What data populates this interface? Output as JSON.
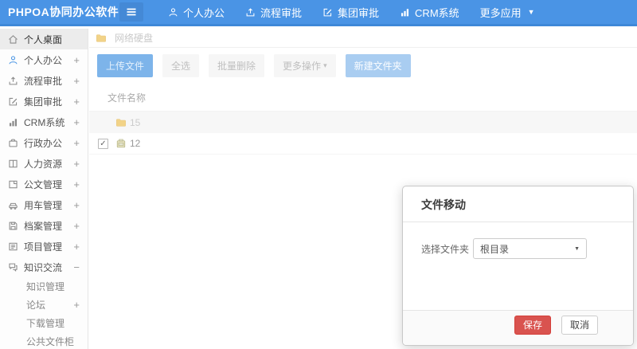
{
  "header": {
    "logo": "PHPOA协同办公软件",
    "nav": [
      {
        "name": "nav-item-personal-office",
        "label": "个人办公",
        "icon": "person-icon"
      },
      {
        "name": "nav-item-workflow-approval",
        "label": "流程审批",
        "icon": "approve-icon"
      },
      {
        "name": "nav-item-group-approval",
        "label": "集团审批",
        "icon": "edit-icon"
      },
      {
        "name": "nav-item-crm-system",
        "label": "CRM系统",
        "icon": "chart-icon"
      },
      {
        "name": "nav-item-more-apps",
        "label": "更多应用",
        "icon": "",
        "caret": "▼"
      }
    ]
  },
  "sidebar": {
    "items": [
      {
        "name": "sidebar-item-personal-desktop",
        "label": "个人桌面",
        "icon": "home-icon",
        "active": true
      },
      {
        "name": "sidebar-item-personal-office",
        "label": "个人办公",
        "icon": "person-icon",
        "icon_color": "#4a95e4",
        "expand": "+"
      },
      {
        "name": "sidebar-item-workflow-approval",
        "label": "流程审批",
        "icon": "approve-icon",
        "expand": "+"
      },
      {
        "name": "sidebar-item-group-approval",
        "label": "集团审批",
        "icon": "edit-icon",
        "expand": "+"
      },
      {
        "name": "sidebar-item-crm-system",
        "label": "CRM系统",
        "icon": "chart-icon",
        "expand": "+"
      },
      {
        "name": "sidebar-item-admin-office",
        "label": "行政办公",
        "icon": "briefcase-icon",
        "expand": "+"
      },
      {
        "name": "sidebar-item-human-resources",
        "label": "人力资源",
        "icon": "book-icon",
        "expand": "+"
      },
      {
        "name": "sidebar-item-document-mgmt",
        "label": "公文管理",
        "icon": "doc-icon",
        "expand": "+"
      },
      {
        "name": "sidebar-item-vehicle-mgmt",
        "label": "用车管理",
        "icon": "car-icon",
        "expand": "+"
      },
      {
        "name": "sidebar-item-archive-mgmt",
        "label": "档案管理",
        "icon": "disk-icon",
        "expand": "+"
      },
      {
        "name": "sidebar-item-project-mgmt",
        "label": "项目管理",
        "icon": "calendar-icon",
        "expand": "+"
      },
      {
        "name": "sidebar-item-knowledge-exchange",
        "label": "知识交流",
        "icon": "chat-icon",
        "expand": "−"
      },
      {
        "name": "sidebar-item-knowledge-mgmt",
        "label": "知识管理",
        "sub": true
      },
      {
        "name": "sidebar-item-forum",
        "label": "论坛",
        "sub": true,
        "expand": "+"
      },
      {
        "name": "sidebar-item-download-mgmt",
        "label": "下载管理",
        "sub": true
      },
      {
        "name": "sidebar-item-public-file-cabinet",
        "label": "公共文件柜",
        "sub": true
      }
    ]
  },
  "main": {
    "breadcrumb": {
      "label": "网络硬盘",
      "icon": "folder-icon"
    },
    "toolbar": [
      {
        "name": "upload-file-button",
        "label": "上传文件",
        "style": "primary"
      },
      {
        "name": "select-all-button",
        "label": "全选",
        "style": "default"
      },
      {
        "name": "batch-delete-button",
        "label": "批量删除",
        "style": "default"
      },
      {
        "name": "more-actions-button",
        "label": "更多操作",
        "style": "default",
        "caret": "▾"
      },
      {
        "name": "new-folder-button",
        "label": "新建文件夹",
        "style": "lightprimary"
      }
    ],
    "table": {
      "header": "文件名称",
      "rows": [
        {
          "name": "15",
          "icon": "folder-icon",
          "checked": false,
          "striped": true
        },
        {
          "name": "12",
          "icon": "archive-icon",
          "checked": true,
          "striped": false
        }
      ]
    }
  },
  "modal": {
    "title": "文件移动",
    "field_label": "选择文件夹",
    "select_value": "根目录",
    "select_caret": "▼",
    "save_label": "保存",
    "cancel_label": "取消"
  },
  "colors": {
    "header_bg": "#4a94e5",
    "header_border": "#3e88d8",
    "accent_blue": "#4a95e4",
    "save_red": "#d9534f",
    "folder_yellow": "#f2d388"
  }
}
